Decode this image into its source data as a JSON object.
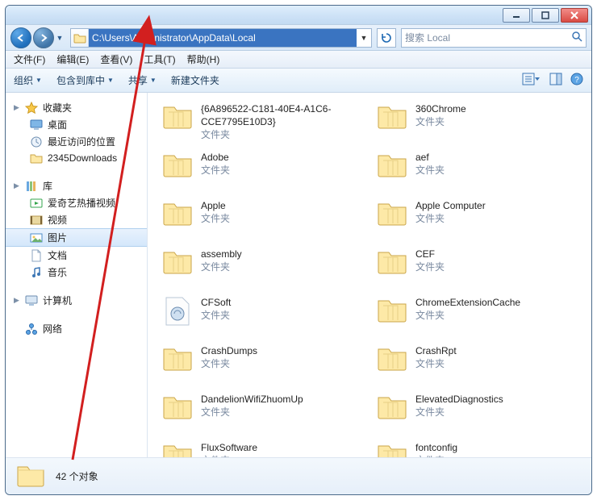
{
  "title_buttons": {
    "min": "—",
    "max": "▢",
    "close": "✕"
  },
  "address": {
    "path": "C:\\Users\\Administrator\\AppData\\Local",
    "search_placeholder": "搜索 Local"
  },
  "menu": [
    "文件(F)",
    "编辑(E)",
    "查看(V)",
    "工具(T)",
    "帮助(H)"
  ],
  "toolbar": {
    "organize": "组织",
    "include": "包含到库中",
    "share": "共享",
    "new_folder": "新建文件夹"
  },
  "sidebar": {
    "favorites": {
      "label": "收藏夹",
      "items": [
        "桌面",
        "最近访问的位置",
        "2345Downloads"
      ]
    },
    "libraries": {
      "label": "库",
      "items": [
        "爱奇艺热播视频",
        "视频",
        "图片",
        "文档",
        "音乐"
      ]
    },
    "computer": {
      "label": "计算机"
    },
    "network": {
      "label": "网络"
    }
  },
  "folder_type_label": "文件夹",
  "folders_col1": [
    "{6A896522-C181-40E4-A1C6-CCE7795E10D3}",
    "Adobe",
    "Apple",
    "assembly",
    "CFSoft",
    "CrashDumps",
    "DandelionWifiZhuomUp",
    "FluxSoftware"
  ],
  "folders_col2": [
    "360Chrome",
    "aef",
    "Apple Computer",
    "CEF",
    "ChromeExtensionCache",
    "CrashRpt",
    "ElevatedDiagnostics",
    "fontconfig"
  ],
  "status": {
    "count_text": "42 个对象"
  }
}
